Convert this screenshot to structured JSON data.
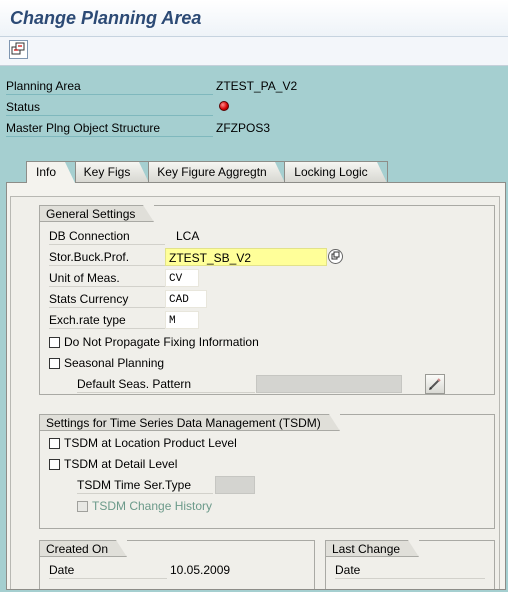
{
  "window": {
    "title": "Change Planning Area"
  },
  "toolbar": {
    "buttons": [
      {
        "icon": "display-change-icon"
      }
    ]
  },
  "header": {
    "planning_area_label": "Planning Area",
    "planning_area_value": "ZTEST_PA_V2",
    "status_label": "Status",
    "status_color": "#d40000",
    "mpos_label": "Master Plng Object Structure",
    "mpos_value": "ZFZPOS3"
  },
  "tabs": [
    {
      "label": "Info",
      "active": true
    },
    {
      "label": "Key Figs",
      "active": false
    },
    {
      "label": "Key Figure Aggregtn",
      "active": false
    },
    {
      "label": "Locking Logic",
      "active": false
    }
  ],
  "general_settings": {
    "title": "General Settings",
    "db_connection_label": "DB Connection",
    "db_connection_value": "LCA",
    "stor_buck_prof_label": "Stor.Buck.Prof.",
    "stor_buck_prof_value": "ZTEST_SB_V2",
    "unit_of_meas_label": "Unit of Meas.",
    "unit_of_meas_value": "CV",
    "stats_currency_label": "Stats Currency",
    "stats_currency_value": "CAD",
    "exch_rate_type_label": "Exch.rate type",
    "exch_rate_type_value": "M",
    "do_not_propagate_label": "Do Not Propagate Fixing Information",
    "do_not_propagate_checked": false,
    "seasonal_planning_label": "Seasonal Planning",
    "seasonal_planning_checked": false,
    "default_seas_pattern_label": "Default Seas. Pattern",
    "default_seas_pattern_value": ""
  },
  "tsdm": {
    "title": "Settings for Time Series Data Management (TSDM)",
    "location_product_label": "TSDM at Location Product Level",
    "location_product_checked": false,
    "detail_level_label": "TSDM at Detail Level",
    "detail_level_checked": false,
    "time_ser_type_label": "TSDM Time Ser.Type",
    "time_ser_type_value": "",
    "change_history_label": "TSDM Change History",
    "change_history_checked": false
  },
  "created_on": {
    "title": "Created On",
    "date_label": "Date",
    "date_value": "10.05.2009"
  },
  "last_change": {
    "title": "Last Change",
    "date_label": "Date",
    "date_value": ""
  }
}
